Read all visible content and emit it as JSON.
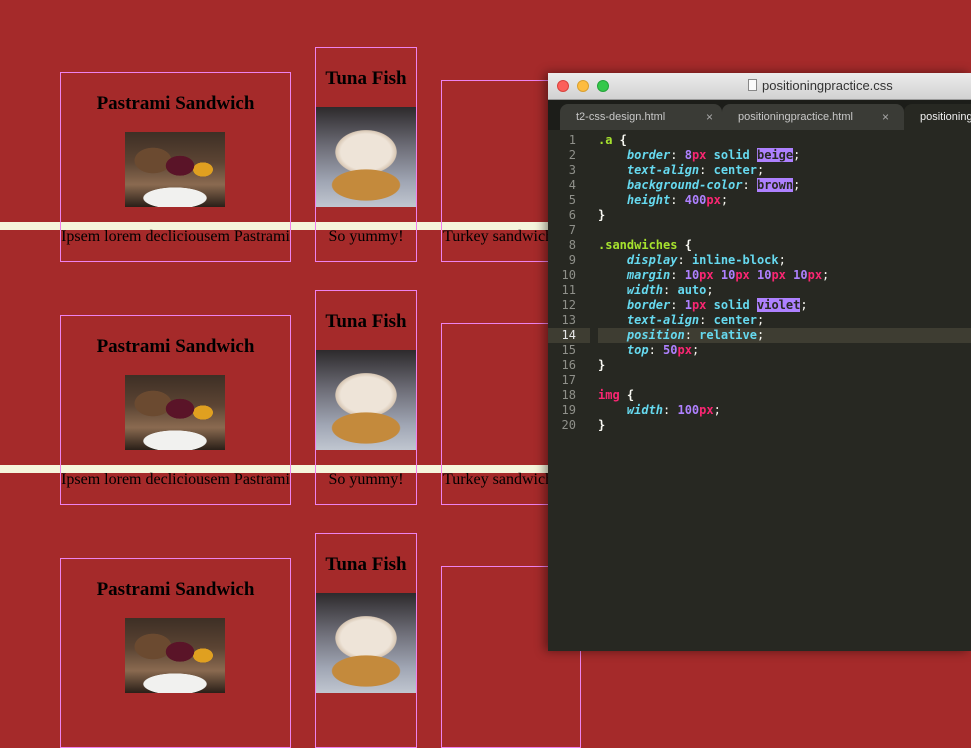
{
  "window": {
    "title": "positioningpractice.css",
    "tabs": [
      {
        "label": "t2-css-design.html",
        "close": "×"
      },
      {
        "label": "positioningpractice.html",
        "close": "×"
      },
      {
        "label": "positioningpractice.css"
      }
    ]
  },
  "page": {
    "rows": [
      {
        "pastrami": {
          "title": "Pastrami Sandwich",
          "caption": "Ipsem lorem decliciousem Pastrami"
        },
        "tuna": {
          "title": "Tuna Fish",
          "caption": "So yummy!"
        },
        "turkey": {
          "caption": "Turkey sandwich"
        }
      },
      {
        "pastrami": {
          "title": "Pastrami Sandwich",
          "caption": "Ipsem lorem decliciousem Pastrami"
        },
        "tuna": {
          "title": "Tuna Fish",
          "caption": "So yummy!"
        },
        "turkey": {
          "caption": "Turkey sandwich"
        }
      },
      {
        "pastrami": {
          "title": "Pastrami Sandwich"
        },
        "tuna": {
          "title": "Tuna Fish"
        }
      }
    ]
  },
  "editor": {
    "current_line": 14,
    "line_numbers": [
      "1",
      "2",
      "3",
      "4",
      "5",
      "6",
      "7",
      "8",
      "9",
      "10",
      "11",
      "12",
      "13",
      "14",
      "15",
      "16",
      "17",
      "18",
      "19",
      "20"
    ],
    "code": {
      "l1": {
        "sel": ".a",
        "brace": " {"
      },
      "l2": {
        "prop": "border",
        "num": "8",
        "unit": "px",
        "kw": "solid",
        "hl": "beige"
      },
      "l3": {
        "prop": "text-align",
        "val": "center"
      },
      "l4": {
        "prop": "background-color",
        "hl": "brown"
      },
      "l5": {
        "prop": "height",
        "num": "400",
        "unit": "px"
      },
      "l6": {
        "brace": "}"
      },
      "l8": {
        "sel": ".sandwiches",
        "brace": " {"
      },
      "l9": {
        "prop": "display",
        "val": "inline-block"
      },
      "l10": {
        "prop": "margin",
        "num": "10",
        "unit": "px"
      },
      "l11": {
        "prop": "width",
        "val": "auto"
      },
      "l12": {
        "prop": "border",
        "num": "1",
        "unit": "px",
        "kw": "solid",
        "hl": "violet"
      },
      "l13": {
        "prop": "text-align",
        "val": "center"
      },
      "l14": {
        "prop": "position",
        "val": "relative"
      },
      "l15": {
        "prop": "top",
        "num": "50",
        "unit": "px"
      },
      "l16": {
        "brace": "}"
      },
      "l18": {
        "sel": "img",
        "brace": " {"
      },
      "l19": {
        "prop": "width",
        "num": "100",
        "unit": "px"
      },
      "l20": {
        "brace": "}"
      }
    }
  },
  "colors": {
    "page_background": "#a52a2a",
    "stripe": "#f5f5dc",
    "card_border": "#ee82ee",
    "editor_background": "#272822"
  }
}
